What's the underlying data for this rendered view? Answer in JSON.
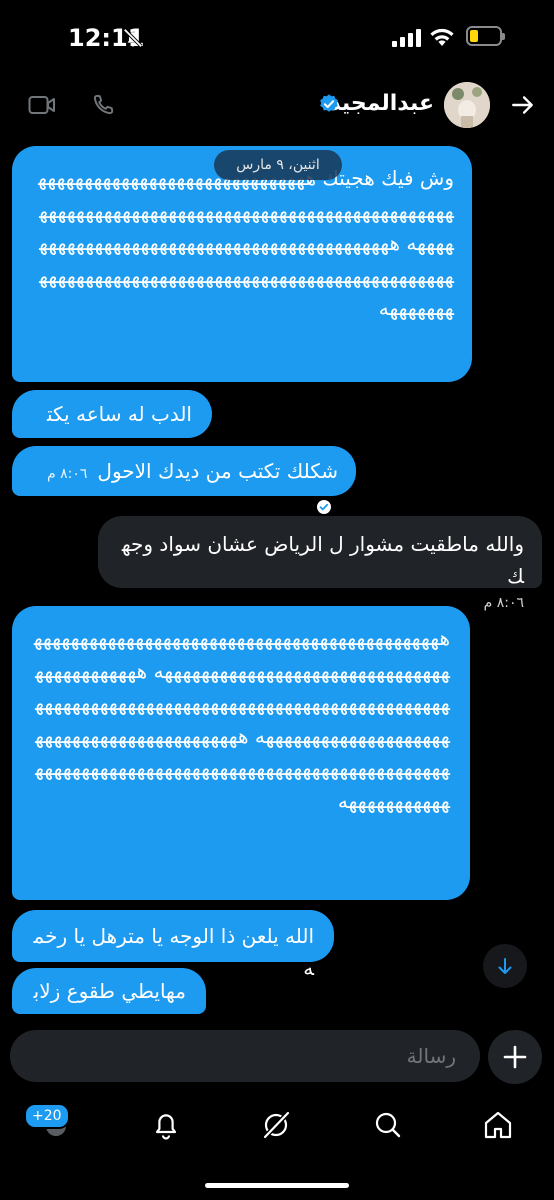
{
  "status_bar": {
    "time": "12:11"
  },
  "header": {
    "contact_name": "عبدالمجيد"
  },
  "date_pill": "اثنين، ٩ مارس",
  "messages": [
    {
      "side": "received",
      "text": "وش فيك هجيتك هههههههههههههههههههههههههههههههههههههههههههههههههههههههههههههههههههههههههههههههه هههههههههههههههههههههههههههههههههههههههههههههههههههههههههههههههههههههههههههههههههههههههههههه"
    },
    {
      "side": "received",
      "text": "الدب له ساعه يكتب"
    },
    {
      "side": "received",
      "text": "شكلك تكتب من ديدك الاحول",
      "time": "٨:٠٦ م"
    },
    {
      "side": "sent",
      "text": "والله ماطقيت مشوار ل الرياض عشان سواد وجهك",
      "time": "٨:٠٦ م"
    },
    {
      "side": "received",
      "text": "ههههههههههههههههههههههههههههههههههههههههههههههههههههههههههههههههههههههههههههه هههههههههههههههههههههههههههههههههههههههههههههههههههههههههههههههههههههههههههههه هههههههههههههههههههههههههههههههههههههههههههههههههههههههههههههههههههههههههههههههه"
    },
    {
      "side": "received",
      "text": "الله يلعن ذا الوجه يا مترهل يا رخمه"
    },
    {
      "side": "received",
      "text": "مهايطي طقوع زلابه"
    }
  ],
  "composer": {
    "placeholder": "رسالة"
  },
  "bottom_nav": {
    "badge": "+20"
  }
}
